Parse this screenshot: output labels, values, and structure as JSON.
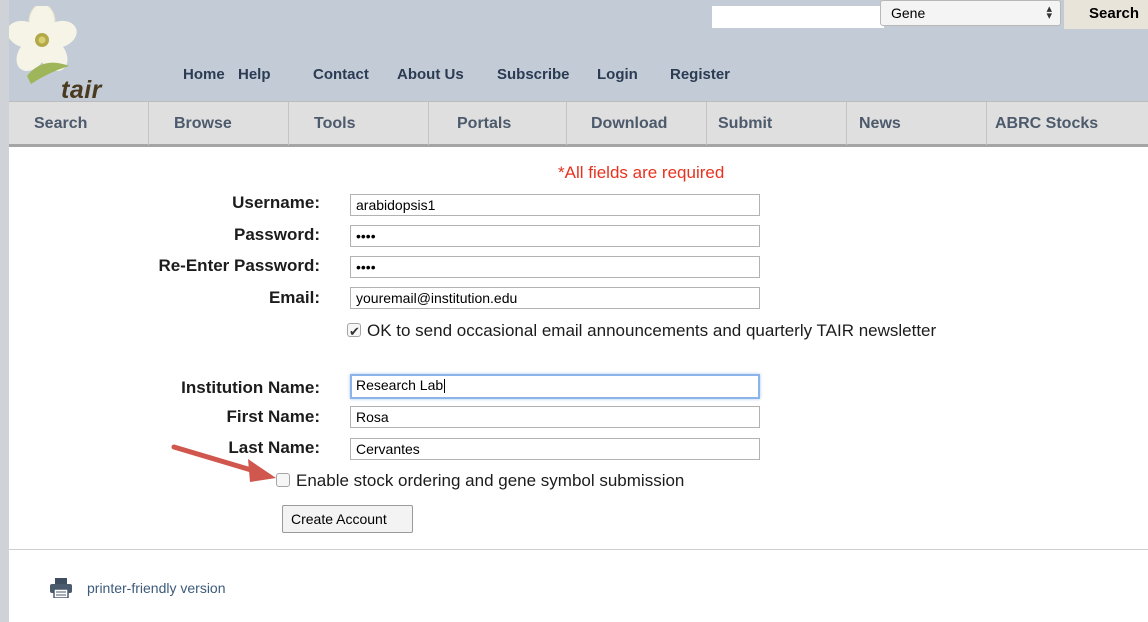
{
  "header": {
    "logo_text": "tair",
    "search_input_value": "",
    "search_type_selected": "Gene",
    "search_button_label": "Search",
    "top_nav": [
      "Home",
      "Help",
      "Contact",
      "About Us",
      "Subscribe",
      "Login",
      "Register"
    ]
  },
  "main_nav": [
    "Search",
    "Browse",
    "Tools",
    "Portals",
    "Download",
    "Submit",
    "News",
    "ABRC Stocks"
  ],
  "form": {
    "required_note": "*All fields are required",
    "username_label": "Username:",
    "username_value": "arabidopsis1",
    "password_label": "Password:",
    "password_value": "••••",
    "reenter_password_label": "Re-Enter Password:",
    "reenter_password_value": "••••",
    "email_label": "Email:",
    "email_value": "youremail@institution.edu",
    "newsletter_checked": true,
    "newsletter_text": "OK to send occasional email announcements and quarterly TAIR newsletter",
    "institution_label": "Institution Name:",
    "institution_value": "Research Lab",
    "first_name_label": "First Name:",
    "first_name_value": "Rosa",
    "last_name_label": "Last Name:",
    "last_name_value": "Cervantes",
    "stock_ordering_checked": false,
    "stock_ordering_text": "Enable stock ordering and gene symbol submission",
    "create_account_label": "Create Account"
  },
  "footer": {
    "printer_link": "printer-friendly version"
  },
  "colors": {
    "header_bg": "#c3ccd6",
    "nav_bg": "#dfdfdf",
    "required_red": "#e6321f",
    "annotation_arrow": "#d0574e"
  }
}
